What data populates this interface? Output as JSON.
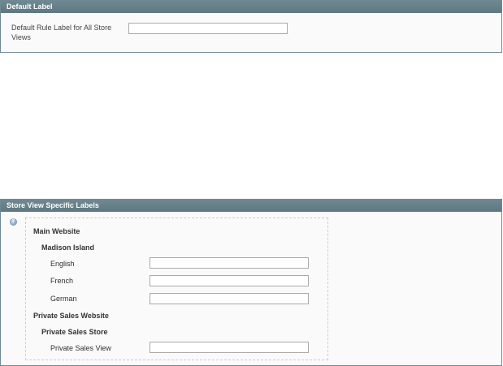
{
  "default_panel": {
    "title": "Default Label",
    "field_label": "Default Rule Label for All Store Views",
    "field_value": ""
  },
  "store_panel": {
    "title": "Store View Specific Labels",
    "help_icon": "help-icon",
    "websites": [
      {
        "name": "Main Website",
        "stores": [
          {
            "name": "Madison Island",
            "views": [
              {
                "label": "English",
                "value": ""
              },
              {
                "label": "French",
                "value": ""
              },
              {
                "label": "German",
                "value": ""
              }
            ]
          }
        ]
      },
      {
        "name": "Private Sales Website",
        "stores": [
          {
            "name": "Private Sales Store",
            "views": [
              {
                "label": "Private Sales View",
                "value": ""
              }
            ]
          }
        ]
      }
    ]
  }
}
